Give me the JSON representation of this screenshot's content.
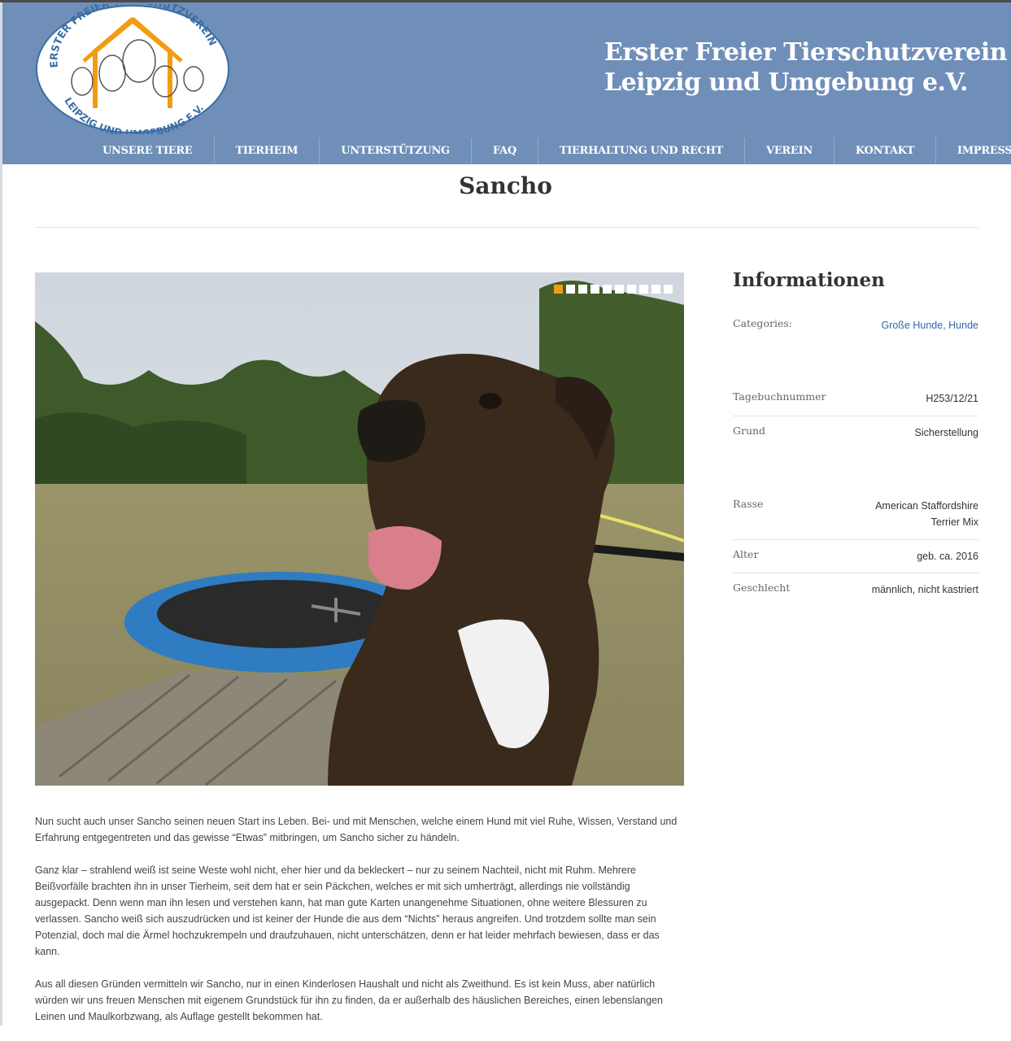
{
  "header": {
    "logo_text_top": "ERSTER FREIER TIERSCHUTZVEREIN",
    "logo_text_bottom": "LEIPZIG UND UMGEBUNG E.V.",
    "title_line1": "Erster Freier Tierschutzverein",
    "title_line2": "Leipzig und Umgebung e.V.",
    "bg_color": "#6f8fb9"
  },
  "nav": {
    "items": [
      "UNSERE TIERE",
      "TIERHEIM",
      "UNTERSTÜTZUNG",
      "FAQ",
      "TIERHALTUNG UND RECHT",
      "VEREIN",
      "KONTAKT",
      "IMPRESSUM"
    ]
  },
  "page": {
    "title": "Sancho"
  },
  "slider": {
    "slide_count": 10,
    "active_index": 0,
    "active_color": "#f39c12"
  },
  "content": {
    "paragraphs": [
      "Nun sucht auch unser Sancho seinen neuen Start ins Leben. Bei- und mit Menschen, welche einem Hund mit viel Ruhe, Wissen, Verstand und Erfahrung entgegentreten und das gewisse “Etwas” mitbringen, um Sancho sicher zu händeln.",
      "Ganz klar – strahlend weiß ist seine Weste wohl nicht, eher hier und da bekleckert – nur zu seinem Nachteil, nicht mit Ruhm. Mehrere Beißvorfälle brachten ihn in unser Tierheim, seit dem hat er sein Päckchen, welches er mit sich umherträgt, allerdings nie vollständig ausgepackt. Denn wenn man ihn lesen und verstehen kann, hat man gute Karten unangenehme Situationen, ohne weitere Blessuren zu verlassen. Sancho weiß sich auszudrücken und ist keiner der Hunde die aus dem “Nichts” heraus angreifen. Und trotzdem sollte man sein Potenzial, doch mal die Ärmel hochzukrempeln und draufzuhauen, nicht unterschätzen, denn er hat leider mehrfach bewiesen, dass er das kann.",
      "Aus all diesen Gründen vermitteln wir Sancho, nur in einen Kinderlosen Haushalt und nicht als Zweithund. Es ist kein Muss, aber natürlich würden wir uns freuen Menschen mit eigenem Grundstück für ihn zu finden, da er außerhalb des häuslichen Bereiches, einen lebenslangen Leinen und Maulkorbzwang, als Auflage gestellt bekommen hat."
    ]
  },
  "sidebar": {
    "title": "Informationen",
    "categories_label": "Categories:",
    "category_1": "Große Hunde",
    "category_sep": ", ",
    "category_2": "Hunde",
    "tagebuch_label": "Tagebuchnummer",
    "tagebuch_value": "H253/12/21",
    "grund_label": "Grund",
    "grund_value": "Sicherstellung",
    "rasse_label": "Rasse",
    "rasse_value_1": "American Staffordshire",
    "rasse_value_2": "Terrier Mix",
    "alter_label": "Alter",
    "alter_value": "geb. ca. 2016",
    "geschlecht_label": "Geschlecht",
    "geschlecht_value": "männlich, nicht kastriert"
  }
}
